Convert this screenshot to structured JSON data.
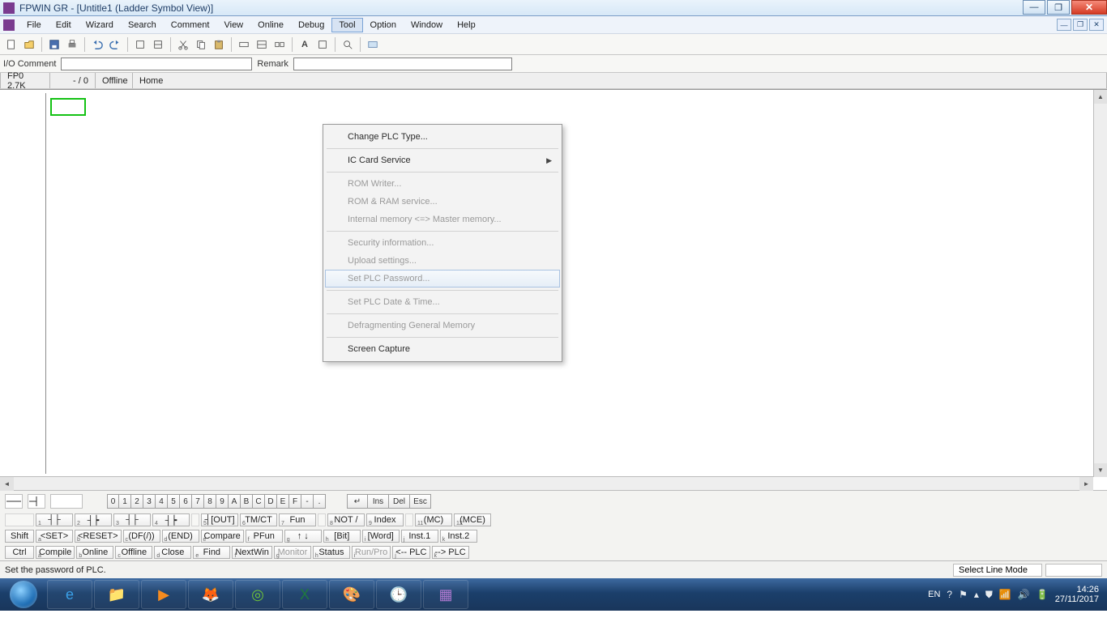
{
  "title": "FPWIN GR - [Untitle1 (Ladder Symbol View)]",
  "menu": {
    "items": [
      "File",
      "Edit",
      "Wizard",
      "Search",
      "Comment",
      "View",
      "Online",
      "Debug",
      "Tool",
      "Option",
      "Window",
      "Help"
    ],
    "active_index": 8
  },
  "comment_bar": {
    "io_label": "I/O Comment",
    "io_value": "",
    "remark_label": "Remark",
    "remark_value": ""
  },
  "status_strip": {
    "plc": "FP0 2.7K",
    "step": "- /      0",
    "mode": "Offline",
    "pos": "Home"
  },
  "tool_menu": {
    "items": [
      {
        "label": "Change PLC Type...",
        "disabled": false
      },
      {
        "label": "IC Card Service",
        "disabled": false,
        "submenu": true
      },
      {
        "label": "ROM Writer...",
        "disabled": true
      },
      {
        "label": "ROM & RAM service...",
        "disabled": true
      },
      {
        "label": "Internal memory <=> Master memory...",
        "disabled": true
      },
      {
        "label": "Security information...",
        "disabled": true
      },
      {
        "label": "Upload settings...",
        "disabled": true
      },
      {
        "label": "Set PLC Password...",
        "disabled": true,
        "highlight": true
      },
      {
        "label": "Set PLC Date & Time...",
        "disabled": true
      },
      {
        "label": "Defragmenting General Memory",
        "disabled": true
      },
      {
        "label": "Screen Capture",
        "disabled": false
      }
    ]
  },
  "keypad": {
    "row": [
      "0",
      "1",
      "2",
      "3",
      "4",
      "5",
      "6",
      "7",
      "8",
      "9",
      "A",
      "B",
      "C",
      "D",
      "E",
      "F",
      "-",
      "."
    ],
    "editkeys": [
      "↵",
      "Ins",
      "Del",
      "Esc"
    ]
  },
  "fkeys_row1": [
    "┤├",
    "┤┝",
    "┤├",
    "┤┝",
    "",
    "┤[OUT]",
    "TM/CT",
    "Fun",
    "",
    "NOT /",
    "Index",
    "",
    "(MC)",
    "(MCE)"
  ],
  "fkeys_row1_sub": [
    "1",
    "2",
    "3",
    "4",
    "",
    "5",
    "6",
    "7",
    "",
    "8",
    "9",
    "",
    "11",
    "12"
  ],
  "fkeys_row2": [
    "Shift",
    "<SET>",
    "<RESET>",
    "(DF(/))",
    "(END)",
    "Compare",
    "PFun",
    "↑  ↓",
    "[Bit]",
    "[Word]",
    "Inst.1",
    "Inst.2"
  ],
  "fkeys_row2_sub": [
    "",
    "a",
    "b",
    "c",
    "d",
    "e",
    "f",
    "g",
    "h",
    "i",
    "j",
    "k"
  ],
  "fkeys_row3": [
    "Ctrl",
    "Compile",
    "Online",
    "Offline",
    "Close",
    "Find",
    "NextWin",
    "Monitor",
    "Status",
    "Run/Pro",
    "<-- PLC",
    "--> PLC"
  ],
  "fkeys_row3_sub": [
    "",
    "a",
    "b",
    "c",
    "d",
    "e",
    "f",
    "g",
    "h",
    "i",
    "j",
    "k"
  ],
  "app_status": {
    "message": "Set the password of PLC.",
    "mode": "Select Line Mode"
  },
  "tray": {
    "lang": "EN",
    "time": "14:26",
    "date": "27/11/2017"
  }
}
